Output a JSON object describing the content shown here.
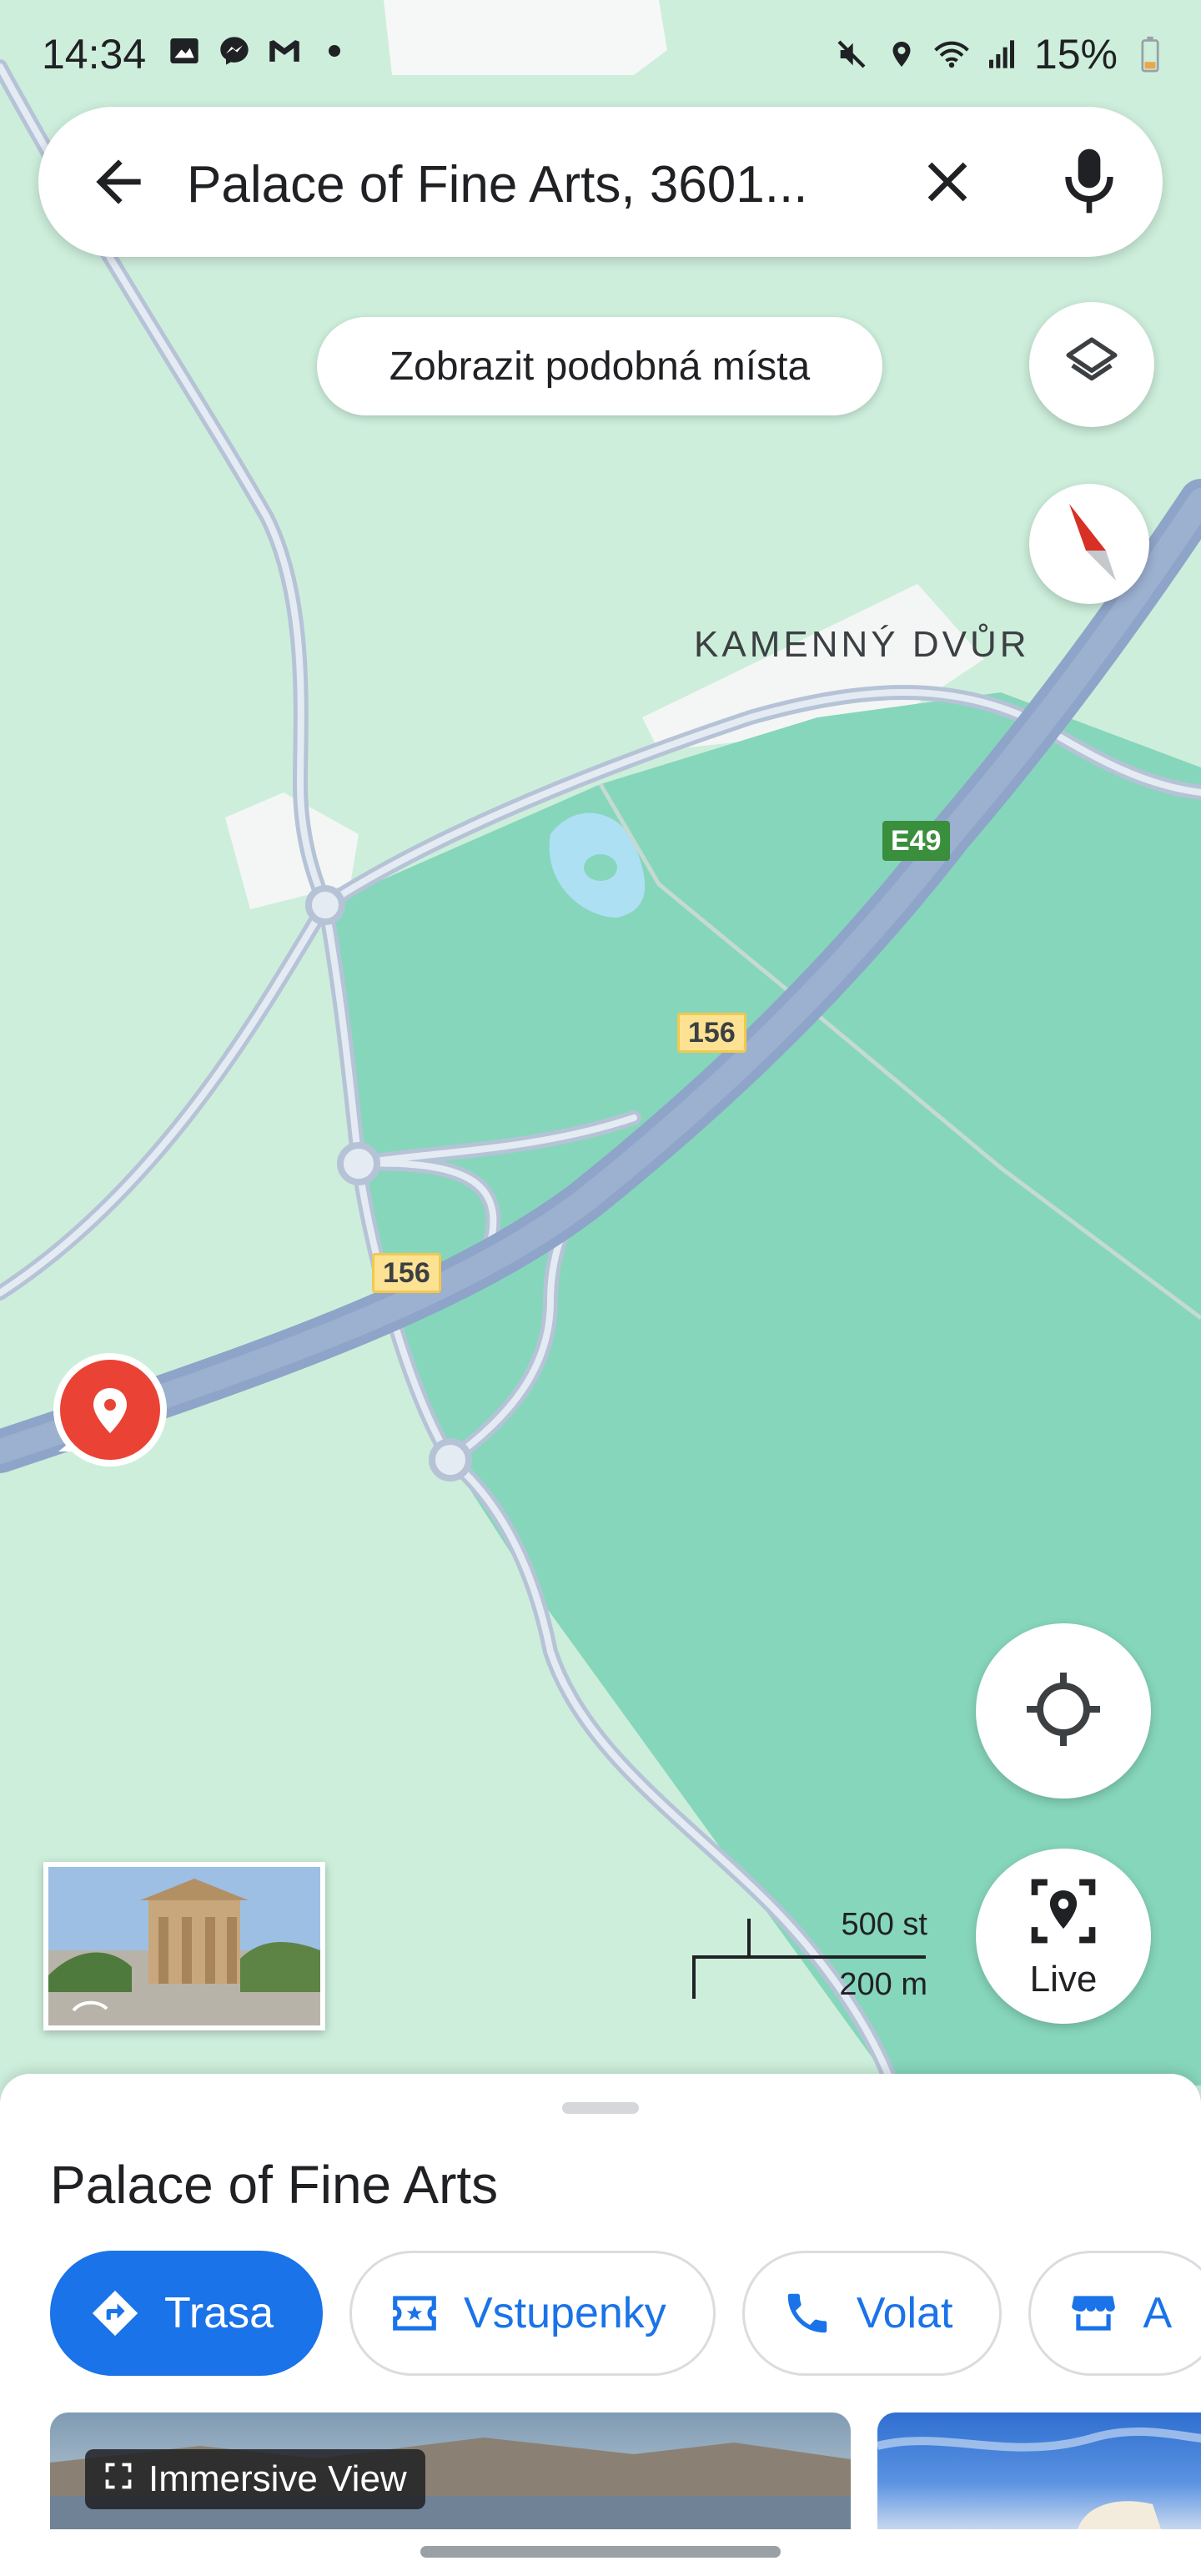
{
  "status_bar": {
    "time": "14:34",
    "battery": "15%"
  },
  "search": {
    "query": "Palace of Fine Arts, 3601..."
  },
  "chip": {
    "label": "Zobrazit podobná místa"
  },
  "map": {
    "area_label": "KAMENNÝ DVŮR",
    "shields": {
      "e49": "E49",
      "r156_a": "156",
      "r156_b": "156"
    },
    "scale": {
      "imperial": "500 st",
      "metric": "200 m"
    }
  },
  "controls": {
    "live_label": "Live"
  },
  "sheet": {
    "title": "Palace of Fine Arts",
    "actions": [
      {
        "label": "Trasa",
        "icon": "directions-icon"
      },
      {
        "label": "Vstupenky",
        "icon": "ticket-icon"
      },
      {
        "label": "Volat",
        "icon": "phone-icon"
      },
      {
        "label": "A",
        "icon": "store-icon"
      }
    ],
    "immersive_label": "Immersive View"
  },
  "colors": {
    "accent": "#1a73e8",
    "map_bg": "#cdeedb",
    "park": "#86d6bc",
    "road": "#8ea4c8",
    "pin": "#ea4335"
  }
}
